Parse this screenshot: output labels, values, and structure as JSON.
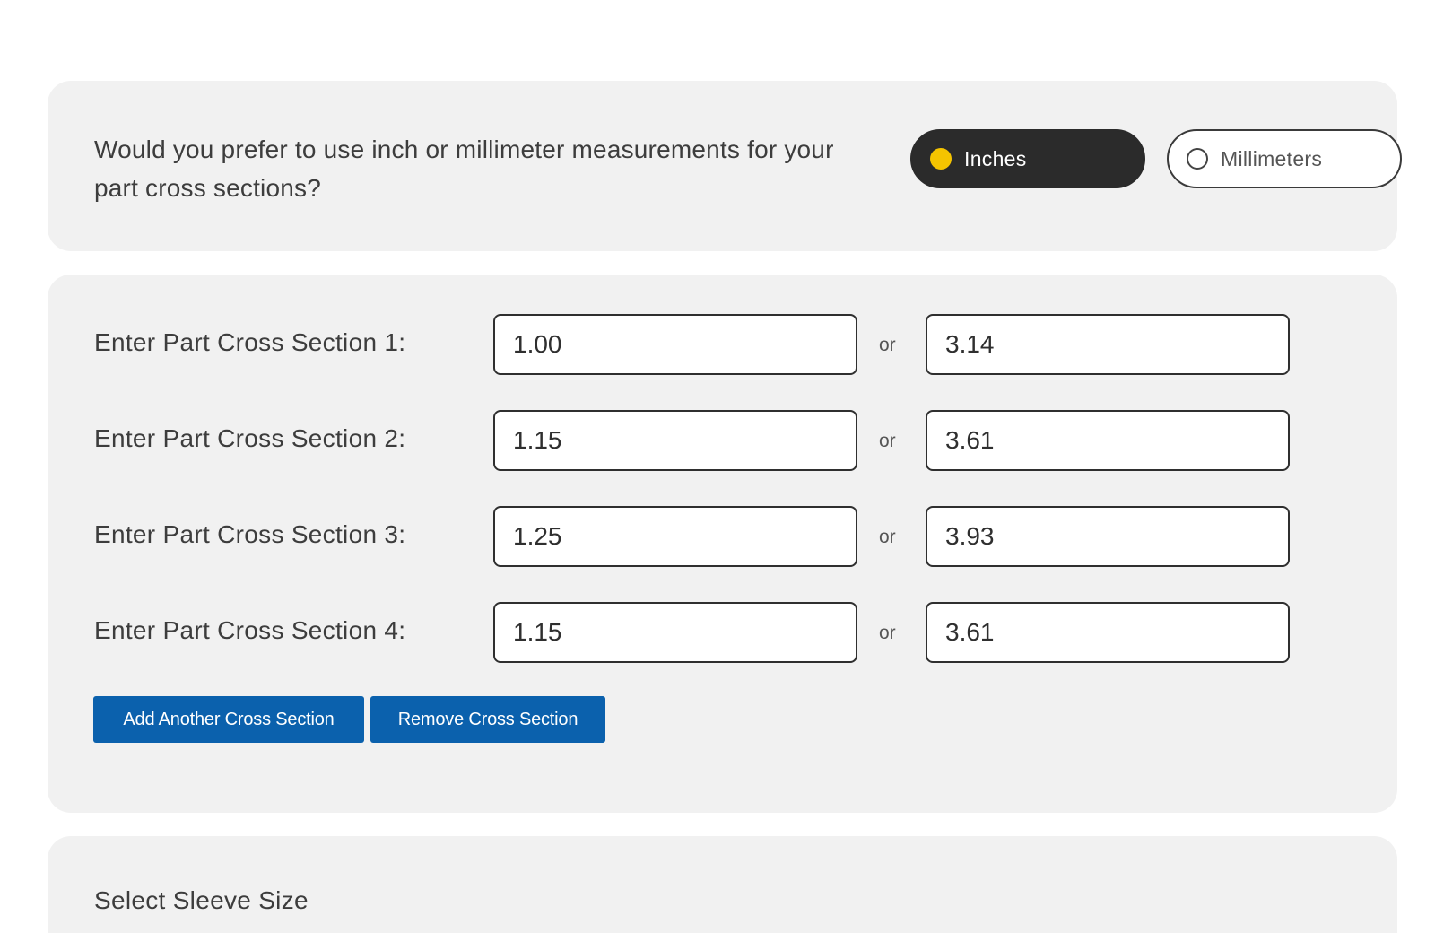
{
  "unit_question": {
    "text": "Would you prefer to use inch or millimeter measurements for your part cross sections?",
    "options": [
      {
        "label": "Inches",
        "selected": true
      },
      {
        "label": "Millimeters",
        "selected": false
      }
    ]
  },
  "cross_sections": {
    "separator": "or",
    "rows": [
      {
        "label": "Enter Part Cross Section 1:",
        "inches": "1.00",
        "mm": "3.14"
      },
      {
        "label": "Enter Part Cross Section 2:",
        "inches": "1.15",
        "mm": "3.61"
      },
      {
        "label": "Enter Part Cross Section 3:",
        "inches": "1.25",
        "mm": "3.93"
      },
      {
        "label": "Enter Part Cross Section 4:",
        "inches": "1.15",
        "mm": "3.61"
      }
    ],
    "add_button": "Add Another Cross Section",
    "remove_button": "Remove Cross Section"
  },
  "sleeve": {
    "title": "Select Sleeve Size"
  },
  "colors": {
    "card_bg": "#f1f1f1",
    "selected_pill": "#2b2b2b",
    "selected_dot": "#f5c400",
    "button_blue": "#0b61ad"
  }
}
